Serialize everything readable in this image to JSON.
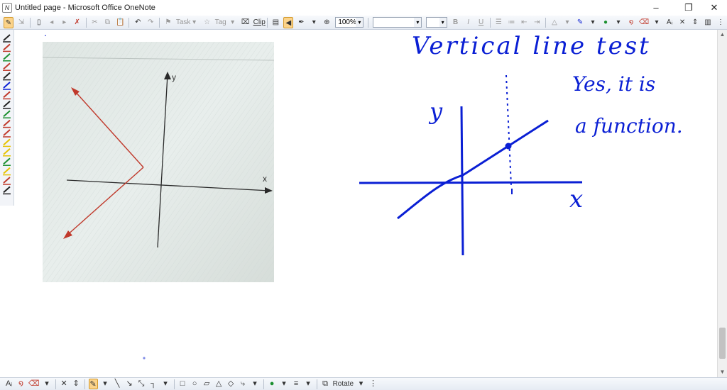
{
  "window": {
    "app_icon": "onenote-icon",
    "title": "Untitled page - Microsoft Office OneNote",
    "minimize_icon": "minimize-icon",
    "restore_icon": "restore-icon",
    "close_icon": "close-icon"
  },
  "toolbar": {
    "task_label": "Task",
    "tag_label": "Tag",
    "clip_label": "Clip",
    "zoom_value": "100%",
    "font_value": "",
    "size_value": "",
    "bold": "B",
    "italic": "I",
    "underline": "U"
  },
  "bottombar": {
    "rotate_label": "Rotate"
  },
  "page": {
    "dot_marker": "."
  },
  "graph_photo": {
    "y_axis_label": "y",
    "x_axis_label": "x"
  },
  "notes": {
    "heading": "Vertical line test",
    "answer_line1": "Yes, it is",
    "answer_line2": "a function.",
    "y_label": "y",
    "x_label": "x"
  },
  "colors": {
    "ink_blue": "#0a1fd4",
    "ray_red": "#c0392b",
    "toolbar_active": "#fbd38a"
  }
}
